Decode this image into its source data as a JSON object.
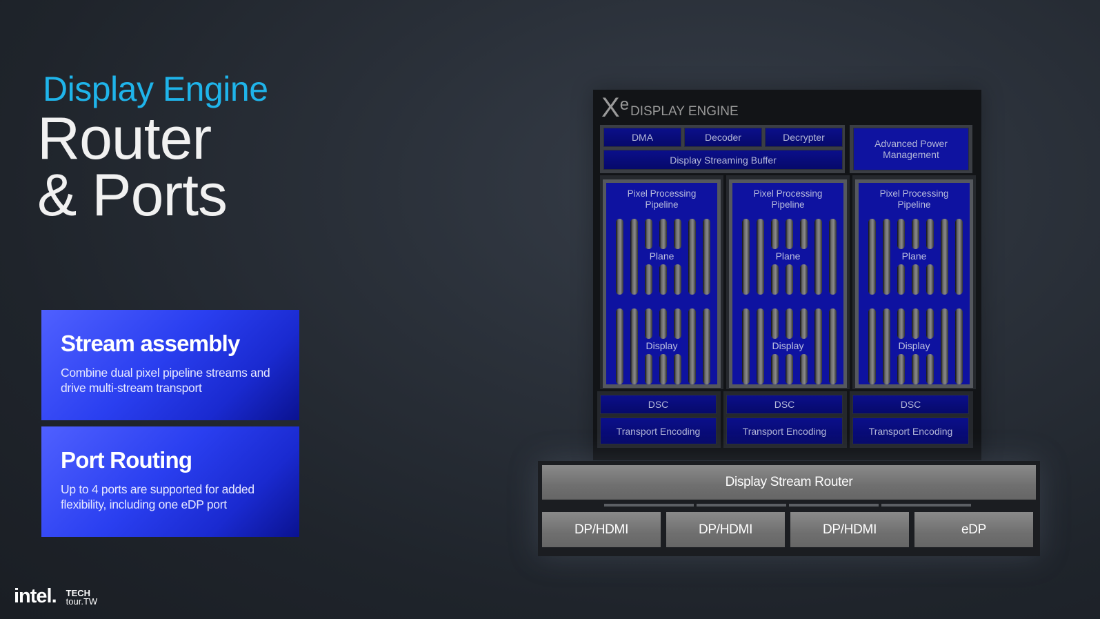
{
  "slide": {
    "kicker": "Display Engine",
    "title_line1": "Router",
    "title_line2": "& Ports"
  },
  "cards": [
    {
      "heading": "Stream assembly",
      "body": "Combine dual pixel pipeline streams and drive multi-stream transport"
    },
    {
      "heading": "Port Routing",
      "body": "Up to 4 ports are supported for added flexibility, including one eDP port"
    }
  ],
  "footer": {
    "brand": "intel.",
    "event_line1": "TECH",
    "event_line2": "tour.TW"
  },
  "diagram": {
    "brand_mark": "X",
    "brand_sup": "e",
    "title": "DISPLAY ENGINE",
    "top_blocks": [
      "DMA",
      "Decoder",
      "Decrypter"
    ],
    "buffer": "Display Streaming Buffer",
    "power": "Advanced Power Management",
    "pipelines": [
      {
        "title": "Pixel Processing Pipeline",
        "plane": "Plane",
        "display": "Display",
        "dsc": "DSC",
        "transport": "Transport Encoding"
      },
      {
        "title": "Pixel Processing Pipeline",
        "plane": "Plane",
        "display": "Display",
        "dsc": "DSC",
        "transport": "Transport Encoding"
      },
      {
        "title": "Pixel Processing Pipeline",
        "plane": "Plane",
        "display": "Display",
        "dsc": "DSC",
        "transport": "Transport Encoding"
      }
    ],
    "router": "Display Stream Router",
    "ports": [
      "DP/HDMI",
      "DP/HDMI",
      "DP/HDMI",
      "eDP"
    ]
  },
  "colors": {
    "accent": "#1fb4ea",
    "block_blue": "#0b0f8a",
    "card_blue": "#2a3ff0"
  }
}
